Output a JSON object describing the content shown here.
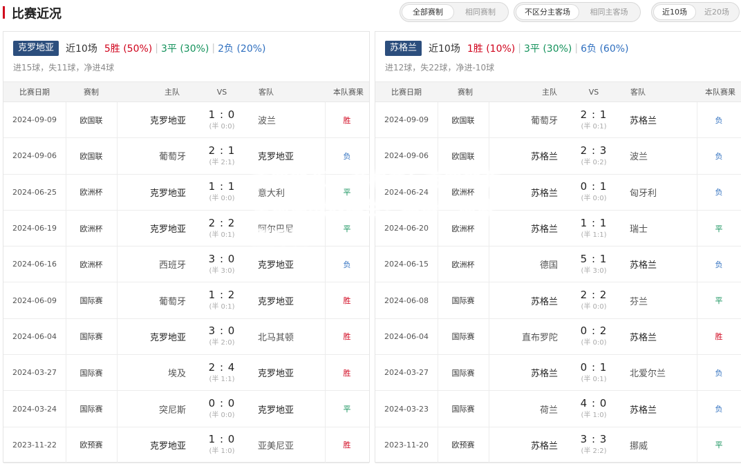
{
  "header": {
    "title": "比赛近况",
    "filter_groups": [
      {
        "options": [
          "全部赛制",
          "相同赛制"
        ],
        "active": 0
      },
      {
        "options": [
          "不区分主客场",
          "相同主客场"
        ],
        "active": 0
      },
      {
        "options": [
          "近10场",
          "近20场"
        ],
        "active": 0
      }
    ]
  },
  "columns": {
    "date": "比赛日期",
    "comp": "赛制",
    "home": "主队",
    "vs": "VS",
    "away": "客队",
    "result": "本队赛果"
  },
  "overlay_text": "克罗地亚vs苏格兰：克罗地亚主场迎战苏格兰，期待一场激烈对决",
  "left": {
    "team": "克罗地亚",
    "recent": "近10场",
    "wins": "5胜 (50%)",
    "draws": "3平 (30%)",
    "losses": "2负 (20%)",
    "goals": "进15球，失11球，净进4球",
    "rows": [
      {
        "date": "2024-09-09",
        "comp": "欧国联",
        "home": "克罗地亚",
        "score": "1 : 0",
        "half": "(半 0:0)",
        "away": "波兰",
        "result": "胜",
        "r": "w"
      },
      {
        "date": "2024-09-06",
        "comp": "欧国联",
        "home": "葡萄牙",
        "score": "2 : 1",
        "half": "(半 2:1)",
        "away": "克罗地亚",
        "result": "负",
        "r": "l"
      },
      {
        "date": "2024-06-25",
        "comp": "欧洲杯",
        "home": "克罗地亚",
        "score": "1 : 1",
        "half": "(半 0:0)",
        "away": "意大利",
        "result": "平",
        "r": "d"
      },
      {
        "date": "2024-06-19",
        "comp": "欧洲杯",
        "home": "克罗地亚",
        "score": "2 : 2",
        "half": "(半 0:1)",
        "away": "阿尔巴尼",
        "result": "平",
        "r": "d"
      },
      {
        "date": "2024-06-16",
        "comp": "欧洲杯",
        "home": "西班牙",
        "score": "3 : 0",
        "half": "(半 3:0)",
        "away": "克罗地亚",
        "result": "负",
        "r": "l"
      },
      {
        "date": "2024-06-09",
        "comp": "国际赛",
        "home": "葡萄牙",
        "score": "1 : 2",
        "half": "(半 0:1)",
        "away": "克罗地亚",
        "result": "胜",
        "r": "w"
      },
      {
        "date": "2024-06-04",
        "comp": "国际赛",
        "home": "克罗地亚",
        "score": "3 : 0",
        "half": "(半 2:0)",
        "away": "北马其顿",
        "result": "胜",
        "r": "w"
      },
      {
        "date": "2024-03-27",
        "comp": "国际赛",
        "home": "埃及",
        "score": "2 : 4",
        "half": "(半 1:1)",
        "away": "克罗地亚",
        "result": "胜",
        "r": "w"
      },
      {
        "date": "2024-03-24",
        "comp": "国际赛",
        "home": "突尼斯",
        "score": "0 : 0",
        "half": "(半 0:0)",
        "away": "克罗地亚",
        "result": "平",
        "r": "d"
      },
      {
        "date": "2023-11-22",
        "comp": "欧预赛",
        "home": "克罗地亚",
        "score": "1 : 0",
        "half": "(半 1:0)",
        "away": "亚美尼亚",
        "result": "胜",
        "r": "w"
      }
    ]
  },
  "right": {
    "team": "苏格兰",
    "recent": "近10场",
    "wins": "1胜 (10%)",
    "draws": "3平 (30%)",
    "losses": "6负 (60%)",
    "goals": "进12球，失22球，净进-10球",
    "rows": [
      {
        "date": "2024-09-09",
        "comp": "欧国联",
        "home": "葡萄牙",
        "score": "2 : 1",
        "half": "(半 0:1)",
        "away": "苏格兰",
        "result": "负",
        "r": "l"
      },
      {
        "date": "2024-09-06",
        "comp": "欧国联",
        "home": "苏格兰",
        "score": "2 : 3",
        "half": "(半 0:2)",
        "away": "波兰",
        "result": "负",
        "r": "l"
      },
      {
        "date": "2024-06-24",
        "comp": "欧洲杯",
        "home": "苏格兰",
        "score": "0 : 1",
        "half": "(半 0:0)",
        "away": "匈牙利",
        "result": "负",
        "r": "l"
      },
      {
        "date": "2024-06-20",
        "comp": "欧洲杯",
        "home": "苏格兰",
        "score": "1 : 1",
        "half": "(半 1:1)",
        "away": "瑞士",
        "result": "平",
        "r": "d"
      },
      {
        "date": "2024-06-15",
        "comp": "欧洲杯",
        "home": "德国",
        "score": "5 : 1",
        "half": "(半 3:0)",
        "away": "苏格兰",
        "result": "负",
        "r": "l"
      },
      {
        "date": "2024-06-08",
        "comp": "国际赛",
        "home": "苏格兰",
        "score": "2 : 2",
        "half": "(半 0:0)",
        "away": "芬兰",
        "result": "平",
        "r": "d"
      },
      {
        "date": "2024-06-04",
        "comp": "国际赛",
        "home": "直布罗陀",
        "score": "0 : 2",
        "half": "(半 0:0)",
        "away": "苏格兰",
        "result": "胜",
        "r": "w"
      },
      {
        "date": "2024-03-27",
        "comp": "国际赛",
        "home": "苏格兰",
        "score": "0 : 1",
        "half": "(半 0:1)",
        "away": "北爱尔兰",
        "result": "负",
        "r": "l"
      },
      {
        "date": "2024-03-23",
        "comp": "国际赛",
        "home": "荷兰",
        "score": "4 : 0",
        "half": "(半 1:0)",
        "away": "苏格兰",
        "result": "负",
        "r": "l"
      },
      {
        "date": "2023-11-20",
        "comp": "欧预赛",
        "home": "苏格兰",
        "score": "3 : 3",
        "half": "(半 2:2)",
        "away": "挪威",
        "result": "平",
        "r": "d"
      }
    ]
  }
}
